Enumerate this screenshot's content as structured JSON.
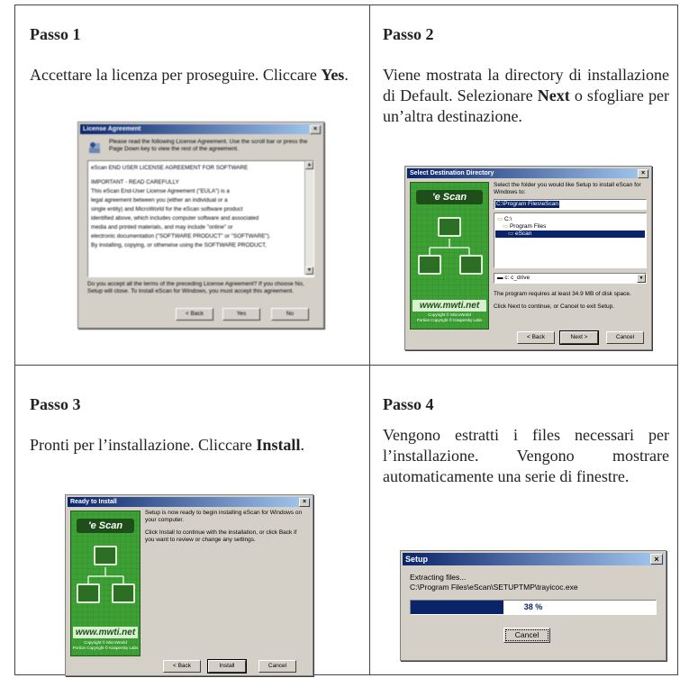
{
  "steps": [
    {
      "title": "Passo 1",
      "text_before": "Accettare la licenza per proseguire. Cliccare ",
      "bold": "Yes",
      "text_after": ".",
      "dialog": {
        "title": "License Agreement",
        "header": "Please read the following License Agreement. Use the scroll bar or press the Page Down key to view the rest of the agreement.",
        "body": [
          "eScan END USER LICENSE AGREEMENT FOR SOFTWARE",
          "IMPORTANT - READ CAREFULLY",
          "This eScan End-User License Agreement (\"EULA\") is a",
          "legal agreement between you (either an individual or a",
          "single entity) and MicroWorld for the eScan software product",
          "identified above, which includes computer software and associated",
          "media and printed materials, and may include \"online\" or",
          "electronic documentation (\"SOFTWARE PRODUCT\" or \"SOFTWARE\").",
          "By installing, copying, or otherwise using the SOFTWARE PRODUCT,"
        ],
        "footer": "Do you accept all the terms of the preceding License Agreement? If you choose No, Setup will close. To install eScan for Windows, you must accept this agreement.",
        "buttons": [
          "< Back",
          "Yes",
          "No"
        ]
      }
    },
    {
      "title": "Passo 2",
      "text_before": "Viene mostrata la directory di installazione di Default. Selezionare ",
      "bold": "Next",
      "text_after": " o sfogliare per un’altra destinazione.",
      "dialog": {
        "title": "Select Destination Directory",
        "instruction": "Select the folder you would like Setup to install eScan for Windows to:",
        "path": "C:\\Program Files\\eScan",
        "tree": [
          "C:\\",
          "Program Files",
          "eScan"
        ],
        "drive": "c: c_drive",
        "requirement": "The program requires at least 34.9 MB of disk space.",
        "hint": "Click Next to continue, or Cancel to exit Setup.",
        "buttons": [
          "< Back",
          "Next >",
          "Cancel"
        ]
      }
    },
    {
      "title": "Passo 3",
      "text_before": "Pronti per l’installazione. Cliccare ",
      "bold": "Install",
      "text_after": ".",
      "dialog": {
        "title": "Ready to Install",
        "p1": "Setup is now ready to begin installing eScan for Windows on your computer.",
        "p2": "Click Install to continue with the installation, or click Back if you want to review or change any settings.",
        "buttons": [
          "< Back",
          "Install",
          "Cancel"
        ]
      }
    },
    {
      "title": "Passo 4",
      "text": "Vengono estratti i files necessari per l’installazione. Vengono mostrare automaticamente una serie di finestre.",
      "dialog": {
        "title": "Setup",
        "line1": "Extracting files...",
        "line2": "C:\\Program Files\\eScan\\SETUPTMP\\trayicoc.exe",
        "progress_percent": 38,
        "progress_label": "38 %",
        "button": "Cancel"
      }
    }
  ],
  "brand": {
    "logo": "'e Scan",
    "site": "www.mwti.net",
    "copyright1": "Copyright © MicroWorld",
    "copyright2": "Portion Copyright © Kaspersky Labs",
    "monitor_label": "AVIRAZEN"
  },
  "colors": {
    "title_bar_start": "#0a246a",
    "title_bar_end": "#a6caf0",
    "dialog_face": "#d4d0c8",
    "escan_green": "#3da035",
    "progress_fill": "#0a246a"
  }
}
